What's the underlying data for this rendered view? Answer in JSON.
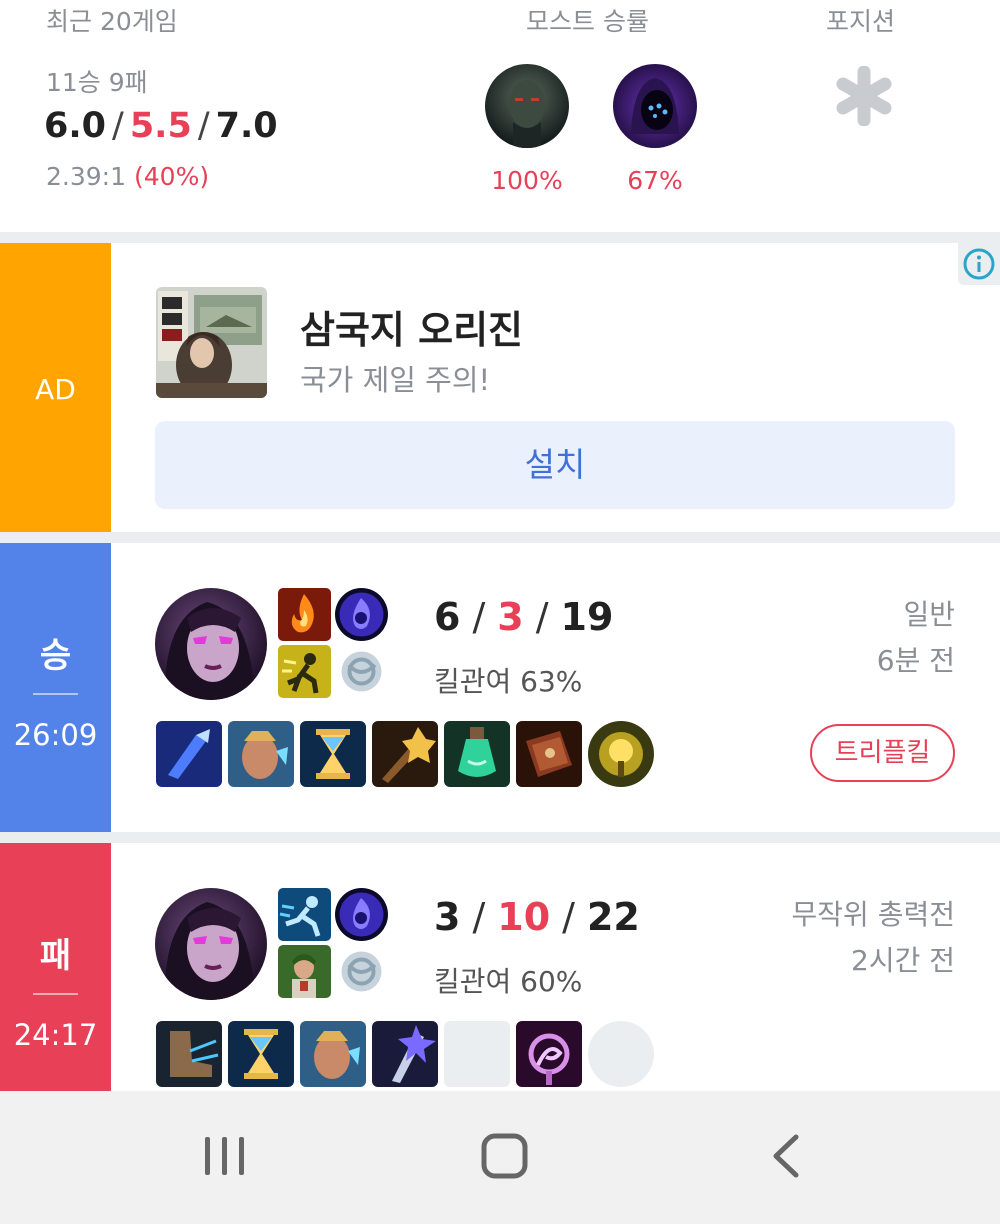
{
  "summary": {
    "recent_label": "최근 20게임",
    "most_label": "모스트 승률",
    "position_label": "포지션",
    "record": "11승 9패",
    "avg_kills": "6.0",
    "avg_deaths": "5.5",
    "avg_assists": "7.0",
    "kda_ratio": "2.39:1",
    "kill_participation": "(40%)",
    "most_champions": [
      {
        "icon": "pyke-champion-icon",
        "winrate": "100%"
      },
      {
        "icon": "hooded-champion-icon",
        "winrate": "67%"
      }
    ],
    "position_icon": "asterisk-icon"
  },
  "ad": {
    "label": "AD",
    "title": "삼국지 오리진",
    "subtitle": "국가 제일 주의!",
    "button_label": "설치",
    "info_icon": "info-icon"
  },
  "matches": [
    {
      "result": "승",
      "duration": "26:09",
      "kills": "6",
      "deaths": "3",
      "assists": "19",
      "kill_participation": "킬관여 63%",
      "mode": "일반",
      "time_ago": "6분 전",
      "badge": "트리플킬",
      "result_color": "#5383e8"
    },
    {
      "result": "패",
      "duration": "24:17",
      "kills": "3",
      "deaths": "10",
      "assists": "22",
      "kill_participation": "킬관여 60%",
      "mode": "무작위 총력전",
      "time_ago": "2시간 전",
      "result_color": "#e84057"
    }
  ],
  "navbar": {
    "recents_icon": "recent-apps-icon",
    "home_icon": "home-icon",
    "back_icon": "back-icon"
  },
  "colors": {
    "win": "#5383e8",
    "loss": "#e84057",
    "ad": "#ffa400",
    "accent_red": "#e84057",
    "install_blue": "#4171d6"
  }
}
